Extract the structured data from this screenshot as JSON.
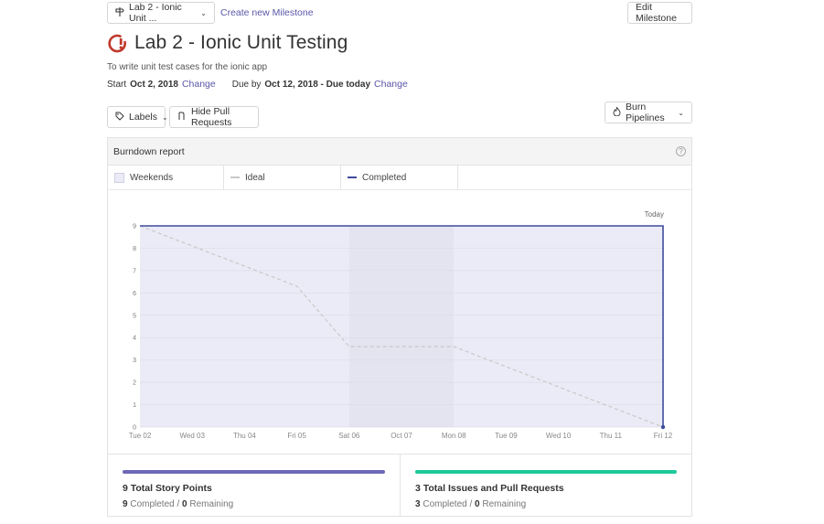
{
  "toolbar": {
    "milestone_select": "Lab 2 - Ionic Unit ...",
    "create_link": "Create new Milestone",
    "edit_button": "Edit Milestone"
  },
  "milestone": {
    "title": "Lab 2 - Ionic Unit Testing",
    "description": "To write unit test cases for the ionic app",
    "start_label": "Start",
    "start_date": "Oct 2, 2018",
    "change_label": "Change",
    "due_label": "Due by",
    "due_date": "Oct 12, 2018 - Due today"
  },
  "filters": {
    "labels_button": "Labels",
    "hide_pr_button": "Hide Pull Requests",
    "burn_button": "Burn Pipelines"
  },
  "report": {
    "title": "Burndown report",
    "help": "?",
    "legend": {
      "weekends": "Weekends",
      "ideal": "Ideal",
      "completed": "Completed"
    },
    "colors": {
      "completed": "#3d4b9c",
      "ideal": "#c8c8c8",
      "plot_fill": "#ebebf7",
      "weekend_fill": "#e4e4f0",
      "grid": "#dcdcea"
    }
  },
  "chart_data": {
    "type": "line",
    "categories": [
      "Tue 02",
      "Wed 03",
      "Thu 04",
      "Fri 05",
      "Sat 06",
      "Oct 07",
      "Mon 08",
      "Tue 09",
      "Wed 10",
      "Thu 11",
      "Fri 12"
    ],
    "y_ticks": [
      0,
      1,
      2,
      3,
      4,
      5,
      6,
      7,
      8,
      9
    ],
    "ylim": [
      0,
      9
    ],
    "weekend": [
      "Sat 06",
      "Mon 08"
    ],
    "marker_label": "Today",
    "series": [
      {
        "name": "Ideal",
        "style": "dashed",
        "values": [
          9,
          8.1,
          7.2,
          6.3,
          3.6,
          3.6,
          3.6,
          2.7,
          1.8,
          0.9,
          0
        ]
      },
      {
        "name": "Completed",
        "style": "solid",
        "values": [
          9,
          9,
          9,
          9,
          9,
          9,
          9,
          9,
          9,
          9,
          0
        ]
      }
    ]
  },
  "stats": {
    "story_points": {
      "title": "9 Total Story Points",
      "completed": "9",
      "completed_label": "Completed",
      "remaining": "0",
      "remaining_label": "Remaining",
      "color": "#6e67b7"
    },
    "issues": {
      "title": "3 Total Issues and Pull Requests",
      "completed": "3",
      "completed_label": "Completed",
      "remaining": "0",
      "remaining_label": "Remaining",
      "color": "#1fc999"
    }
  }
}
